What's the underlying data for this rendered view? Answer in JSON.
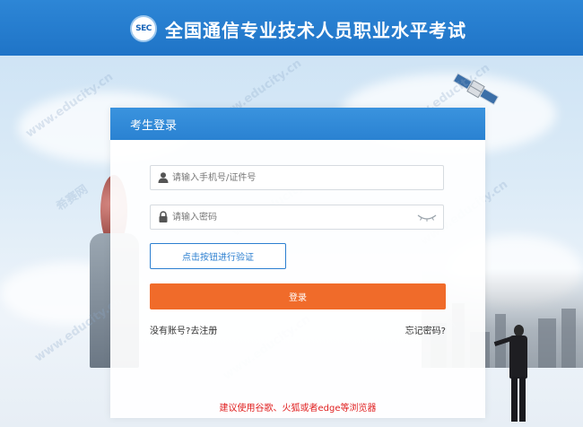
{
  "header": {
    "logo_text": "SEC",
    "title": "全国通信专业技术人员职业水平考试"
  },
  "login": {
    "title": "考生登录",
    "phone_placeholder": "请输入手机号/证件号",
    "password_placeholder": "请输入密码",
    "verify_label": "点击按钮进行验证",
    "submit_label": "登录",
    "no_account_text": "没有账号?",
    "register_label": "去注册",
    "forgot_label": "忘记密码?",
    "browser_tip": "建议使用谷歌、火狐或者edge等浏览器"
  },
  "watermark": {
    "site": "www.educity.cn",
    "brand": "希赛网"
  },
  "icons": {
    "user": "user-icon",
    "lock": "lock-icon",
    "eye": "eye-icon",
    "satellite": "satellite-icon"
  },
  "colors": {
    "header_blue": "#2d86d6",
    "panel_header_blue": "#3a93de",
    "login_orange": "#f06b2a",
    "verify_blue": "#2c7fd0",
    "tip_red": "#e02020"
  }
}
